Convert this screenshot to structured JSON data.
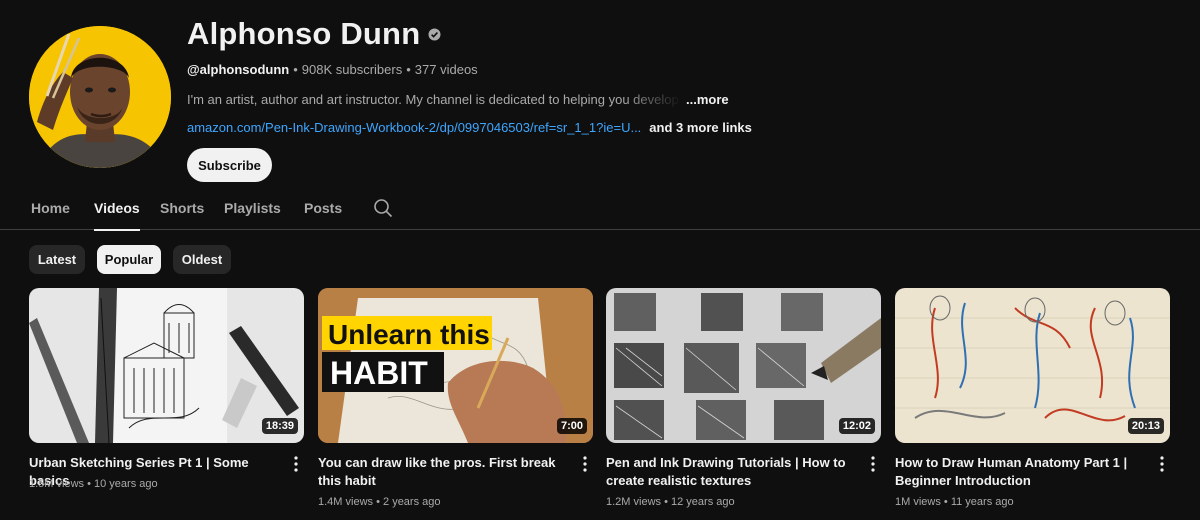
{
  "channel": {
    "name": "Alphonso Dunn",
    "handle": "@alphonsodunn",
    "subscribers": "908K subscribers",
    "videos_count": "377 videos",
    "separator": "•",
    "description": "I'm an artist, author and art instructor. My channel is dedicated to helping you develop and improve your drawing skills",
    "more_label": "...more",
    "link_url": "amazon.com/Pen-Ink-Drawing-Workbook-2/dp/0997046503/ref=sr_1_1?ie=U...",
    "more_links": "and 3 more links",
    "subscribe_label": "Subscribe"
  },
  "tabs": [
    {
      "label": "Home",
      "active": false
    },
    {
      "label": "Videos",
      "active": true
    },
    {
      "label": "Shorts",
      "active": false
    },
    {
      "label": "Playlists",
      "active": false
    },
    {
      "label": "Posts",
      "active": false
    }
  ],
  "chips": [
    {
      "label": "Latest",
      "active": false
    },
    {
      "label": "Popular",
      "active": true
    },
    {
      "label": "Oldest",
      "active": false
    }
  ],
  "videos": [
    {
      "title": "Urban Sketching Series Pt 1 | Some basics",
      "views": "1.5M views",
      "age": "10 years ago",
      "duration": "18:39"
    },
    {
      "title": "You can draw like the pros. First break this habit",
      "views": "1.4M views",
      "age": "2 years ago",
      "duration": "7:00",
      "thumb_text_1": "Unlearn this",
      "thumb_text_2": "HABIT"
    },
    {
      "title": "Pen and Ink Drawing Tutorials | How to create realistic textures",
      "views": "1.2M views",
      "age": "12 years ago",
      "duration": "12:02"
    },
    {
      "title": "How to Draw Human Anatomy Part 1 | Beginner Introduction",
      "views": "1M views",
      "age": "11 years ago",
      "duration": "20:13"
    }
  ],
  "colors": {
    "background": "#0f0f0f",
    "link": "#3ea6ff",
    "avatar_bg": "#f6c400",
    "thumb_yellow": "#ffd400"
  },
  "icons": {
    "verified": "verified-check-icon",
    "search": "search-icon",
    "more_actions": "kebab-menu-icon"
  }
}
